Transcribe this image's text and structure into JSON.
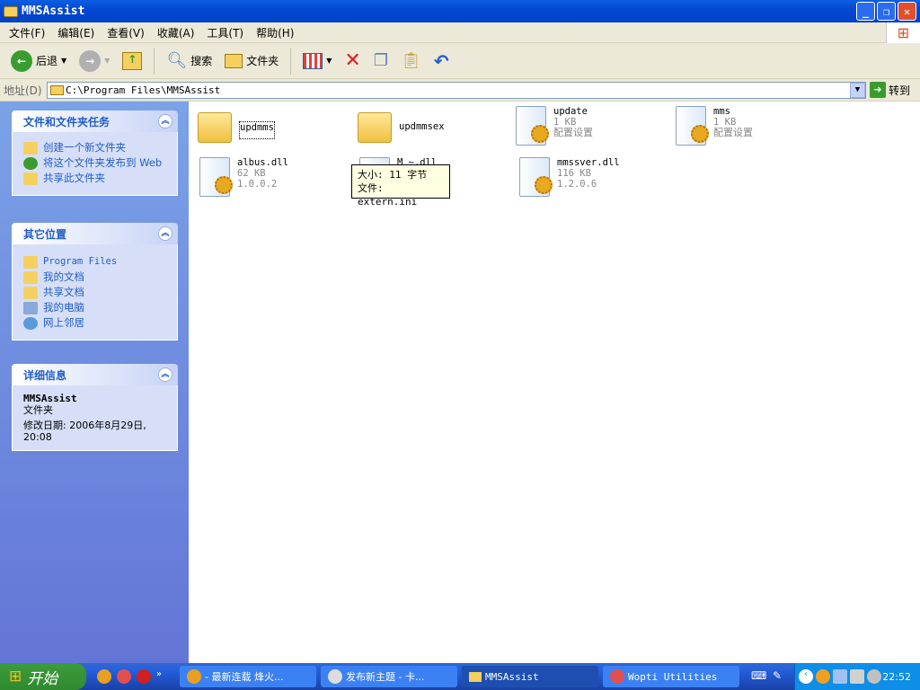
{
  "window": {
    "title": "MMSAssist"
  },
  "menu": [
    "文件(F)",
    "编辑(E)",
    "查看(V)",
    "收藏(A)",
    "工具(T)",
    "帮助(H)"
  ],
  "toolbar": {
    "back": "后退",
    "search": "搜索",
    "folders": "文件夹"
  },
  "address": {
    "label": "地址(D)",
    "value": "C:\\Program Files\\MMSAssist",
    "go": "转到"
  },
  "tasks": {
    "title": "文件和文件夹任务",
    "items": [
      "创建一个新文件夹",
      "将这个文件夹发布到 Web",
      "共享此文件夹"
    ]
  },
  "places": {
    "title": "其它位置",
    "items": [
      "Program Files",
      "我的文档",
      "共享文档",
      "我的电脑",
      "网上邻居"
    ]
  },
  "details": {
    "title": "详细信息",
    "name": "MMSAssist",
    "type": "文件夹",
    "modified": "修改日期: 2006年8月29日, 20:08"
  },
  "files": [
    {
      "name": "updmms",
      "kind": "folder"
    },
    {
      "name": "updmmsex",
      "kind": "folder"
    },
    {
      "name": "update",
      "size": "1 KB",
      "type": "配置设置"
    },
    {
      "name": "mms",
      "size": "1 KB",
      "type": "配置设置"
    },
    {
      "name": "albus.dll",
      "size": "62 KB",
      "version": "1.0.0.2"
    },
    {
      "name": "M    ~.dll"
    },
    {
      "name": "mmssver.dll",
      "size": "116 KB",
      "version": "1.2.0.6"
    }
  ],
  "tooltip": {
    "size": "大小: 11 字节",
    "file": "文件: extern.ini"
  },
  "taskbar": {
    "start": "开始",
    "tasks": [
      "- 最新连载 烽火...",
      "发布新主题 - 卡...",
      "MMSAssist",
      "Wopti Utilities"
    ],
    "clock": "22:52"
  }
}
